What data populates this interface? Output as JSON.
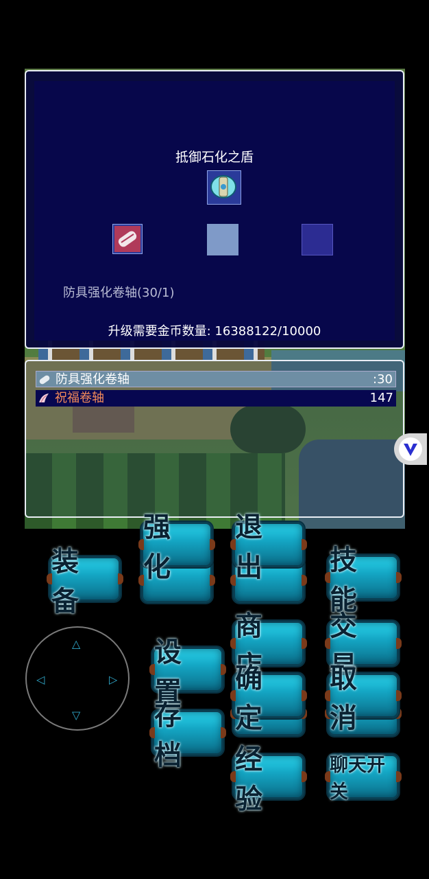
{
  "enhance_panel": {
    "item_name": "抵御石化之盾",
    "material": "防具强化卷轴(30/1)",
    "gold_cost": "升级需要金币数量: 16388122/10000"
  },
  "inventory": [
    {
      "name": "防具强化卷轴",
      "count": ":30",
      "icon": "scroll-icon"
    },
    {
      "name": "祝福卷轴",
      "count": "147",
      "icon": "wing-icon"
    }
  ],
  "buttons": {
    "enhance": "强化",
    "exit": "退出",
    "equip": "装备",
    "skills": "技能",
    "settings": "设置",
    "shop": "商店",
    "trade": "交易",
    "confirm": "确定",
    "cancel": "取消",
    "save": "存档",
    "experience": "经验",
    "chat_toggle": "聊天开关"
  },
  "colors": {
    "panel_bg": "#07074b",
    "button_cyan": "#14a6c4",
    "highlight_row": "#6e8ea4",
    "secondary_item": "#f28a5a"
  }
}
